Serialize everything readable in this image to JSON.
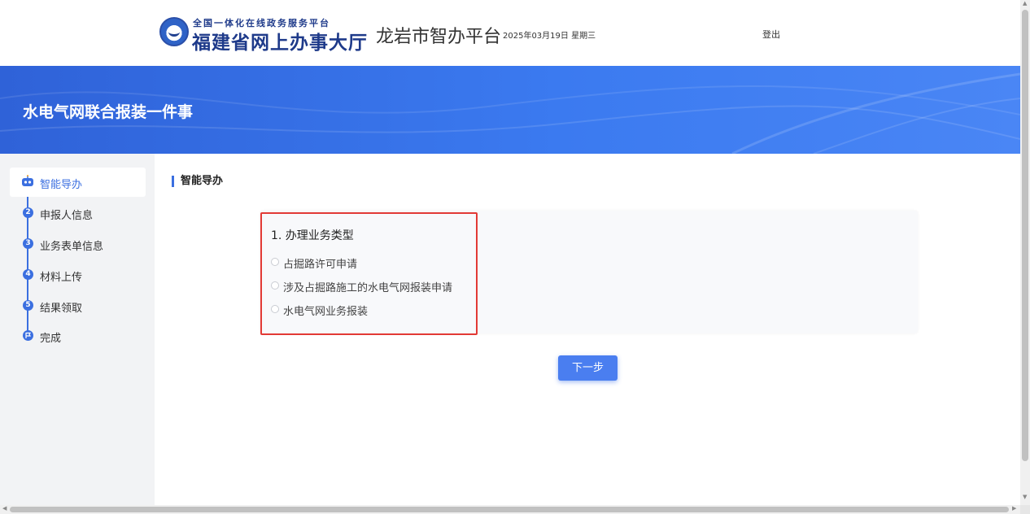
{
  "header": {
    "logo_line1": "全国一体化在线政务服务平台",
    "logo_line2": "福建省网上办事大厅",
    "city_title": "龙岩市智办平台",
    "date": "2025年03月19日 星期三",
    "logout": "登出"
  },
  "banner": {
    "title": "水电气网联合报装一件事"
  },
  "sidebar": {
    "steps": [
      {
        "number": "",
        "label": "智能导办",
        "icon": "robot-icon",
        "active": true
      },
      {
        "number": "2",
        "label": "申报人信息"
      },
      {
        "number": "3",
        "label": "业务表单信息"
      },
      {
        "number": "4",
        "label": "材料上传"
      },
      {
        "number": "5",
        "label": "结果领取"
      },
      {
        "number": "",
        "label": "完成",
        "icon": "flag-icon"
      }
    ]
  },
  "main": {
    "section_title": "智能导办",
    "question": {
      "title": "1. 办理业务类型",
      "options": [
        "占掘路许可申请",
        "涉及占掘路施工的水电气网报装申请",
        "水电气网业务报装"
      ]
    },
    "next_button": "下一步"
  },
  "colors": {
    "accent": "#3b6fe0",
    "banner": "#3b7af0",
    "highlight_border": "#e23a35"
  }
}
